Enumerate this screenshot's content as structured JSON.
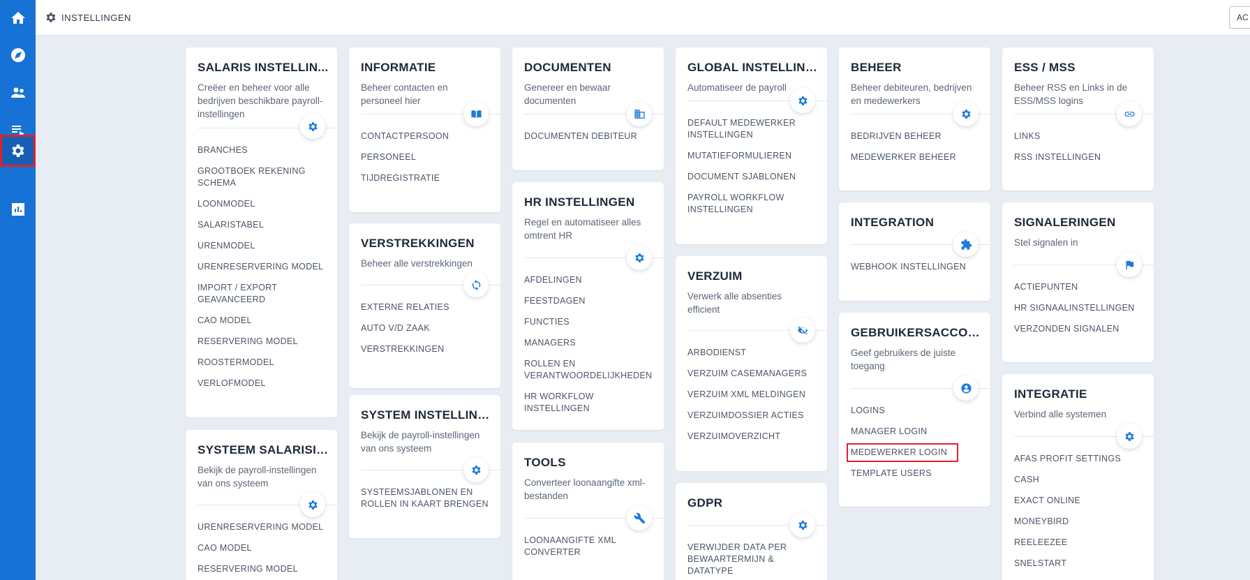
{
  "header": {
    "breadcrumb": "INSTELLINGEN",
    "right_button": "AC"
  },
  "sidebar": {
    "items": [
      {
        "icon": "home-icon"
      },
      {
        "icon": "compass-icon"
      },
      {
        "icon": "users-icon"
      },
      {
        "icon": "list-icon"
      },
      {
        "icon": "gear-icon",
        "active": true
      },
      {
        "icon": "chart-icon"
      }
    ]
  },
  "cards": {
    "salaris": {
      "title": "SALARIS INSTELLIN...",
      "desc": "Creëer en beheer voor alle bedrijven beschikbare payroll-instellingen",
      "icon": "gear-icon",
      "links": [
        "BRANCHES",
        "GROOTBOEK REKENING SCHEMA",
        "LOONMODEL",
        "SALARISTABEL",
        "URENMODEL",
        "URENRESERVERING MODEL",
        "IMPORT / EXPORT GEAVANCEERD",
        "CAO MODEL",
        "RESERVERING MODEL",
        "ROOSTERMODEL",
        "VERLOFMODEL"
      ]
    },
    "systeem_salaris": {
      "title": "SYSTEEM SALARISIN...",
      "desc": "Bekijk de payroll-instellingen van ons systeem",
      "icon": "gear-icon",
      "links": [
        "URENRESERVERING MODEL",
        "CAO MODEL",
        "RESERVERING MODEL"
      ]
    },
    "informatie": {
      "title": "INFORMATIE",
      "desc": "Beheer contacten en personeel hier",
      "icon": "book-icon",
      "links": [
        "CONTACTPERSOON",
        "PERSONEEL",
        "TIJDREGISTRATIE"
      ]
    },
    "verstrekkingen": {
      "title": "VERSTREKKINGEN",
      "desc": "Beheer alle verstrekkingen",
      "icon": "sync-icon",
      "links": [
        "EXTERNE RELATIES",
        "AUTO V/D ZAAK",
        "VERSTREKKINGEN"
      ]
    },
    "system_instelling": {
      "title": "SYSTEM INSTELLING...",
      "desc": "Bekijk de payroll-instellingen van ons systeem",
      "icon": "gear-icon",
      "links": [
        "SYSTEEMSJABLONEN EN ROLLEN IN KAART BRENGEN"
      ]
    },
    "documenten": {
      "title": "DOCUMENTEN",
      "desc": "Genereer en bewaar documenten",
      "icon": "building-icon",
      "links": [
        "DOCUMENTEN DEBITEUR"
      ]
    },
    "hr": {
      "title": "HR INSTELLINGEN",
      "desc": "Regel en automatiseer alles omtrent HR",
      "icon": "gear-icon",
      "links": [
        "AFDELINGEN",
        "FEESTDAGEN",
        "FUNCTIES",
        "MANAGERS",
        "ROLLEN EN VERANTWOORDELIJKHEDEN",
        "HR WORKFLOW INSTELLINGEN"
      ]
    },
    "tools": {
      "title": "TOOLS",
      "desc": "Converteer loonaangifte xml-bestanden",
      "icon": "wrench-icon",
      "links": [
        "LOONAANGIFTE XML CONVERTER"
      ]
    },
    "global": {
      "title": "GLOBAL INSTELLING...",
      "desc": "Automatiseer de payroll",
      "icon": "gear-icon",
      "links": [
        "DEFAULT MEDEWERKER INSTELLINGEN",
        "MUTATIEFORMULIEREN",
        "DOCUMENT SJABLONEN",
        "PAYROLL WORKFLOW INSTELLINGEN"
      ]
    },
    "verzuim": {
      "title": "VERZUIM",
      "desc": "Verwerk alle absenties efficient",
      "icon": "eye-off-icon",
      "links": [
        "ARBODIENST",
        "VERZUIM CASEMANAGERS",
        "VERZUIM XML MELDINGEN",
        "VERZUIMDOSSIER ACTIES",
        "VERZUIMOVERZICHT"
      ]
    },
    "gdpr": {
      "title": "GDPR",
      "desc": "",
      "icon": "gear-icon",
      "links": [
        "VERWIJDER DATA PER BEWAARTERMIJN & DATATYPE"
      ]
    },
    "beheer": {
      "title": "BEHEER",
      "desc": "Beheer debiteuren, bedrijven en medewerkers",
      "icon": "gear-icon",
      "links": [
        "BEDRIJVEN BEHEER",
        "MEDEWERKER BEHEER"
      ]
    },
    "integration": {
      "title": "INTEGRATION",
      "desc": "",
      "icon": "puzzle-icon",
      "links": [
        "WEBHOOK INSTELLINGEN"
      ]
    },
    "gebruikers": {
      "title": "GEBRUIKERSACCOU...",
      "desc": "Geef gebruikers de juiste toegang",
      "icon": "account-icon",
      "links": [
        "LOGINS",
        "MANAGER LOGIN",
        "MEDEWERKER LOGIN",
        "TEMPLATE USERS"
      ]
    },
    "ess": {
      "title": "ESS / MSS",
      "desc": "Beheer RSS en Links in de ESS/MSS logins",
      "icon": "link-icon",
      "links": [
        "LINKS",
        "RSS INSTELLINGEN"
      ]
    },
    "signaleringen": {
      "title": "SIGNALERINGEN",
      "desc": "Stel signalen in",
      "icon": "flag-icon",
      "links": [
        "ACTIEPUNTEN",
        "HR SIGNAALINSTELLINGEN",
        "VERZONDEN SIGNALEN"
      ]
    },
    "integratie": {
      "title": "INTEGRATIE",
      "desc": "Verbind alle systemen",
      "icon": "gear-icon",
      "links": [
        "AFAS PROFIT SETTINGS",
        "CASH",
        "EXACT ONLINE",
        "MONEYBIRD",
        "REELEEZEE",
        "SNELSTART"
      ]
    }
  },
  "highlighted_link": "MEDEWERKER LOGIN"
}
